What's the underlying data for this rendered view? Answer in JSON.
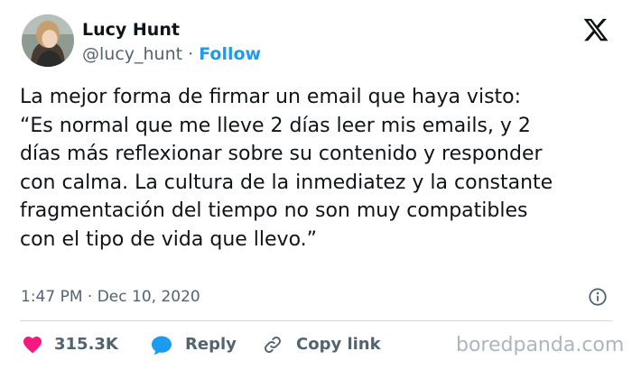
{
  "author": {
    "name": "Lucy Hunt",
    "handle": "@lucy_hunt",
    "separator": " · ",
    "follow_label": "Follow"
  },
  "tweet": {
    "text": "La mejor forma de firmar un email que haya visto:\n“Es normal que me lleve 2 días leer mis emails, y 2\ndías más reflexionar sobre su contenido y responder\ncon calma. La cultura de la inmediatez y la constante\nfragmentación del tiempo no son muy compatibles\ncon el tipo de vida que llevo.”",
    "timestamp": "1:47 PM · Dec 10, 2020"
  },
  "actions": {
    "like_count": "315.3K",
    "reply_label": "Reply",
    "copy_link_label": "Copy link"
  },
  "watermark": "boredpanda.com",
  "icons": {
    "platform_logo": "x-logo-icon",
    "info": "info-icon",
    "like": "heart-icon",
    "reply": "speech-bubble-icon",
    "copy_link": "link-icon"
  },
  "colors": {
    "accent": "#1d9bf0",
    "like": "#f91880",
    "text_primary": "#0f1419",
    "text_secondary": "#536471",
    "divider": "#cfd9de",
    "watermark": "#aeb6bd"
  }
}
